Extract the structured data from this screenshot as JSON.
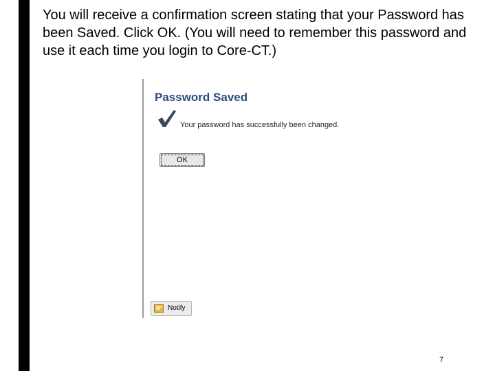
{
  "slide": {
    "instructions": "You will receive a confirmation screen stating that your Password has been Saved.  Click OK.  (You will need to remember this password and use it each time you login to Core-CT.)",
    "page_number": "7"
  },
  "screenshot": {
    "title": "Password Saved",
    "message": "Your password has successfully been changed.",
    "ok_label": "OK",
    "notify_label": "Notify",
    "icons": {
      "check": "checkmark-icon",
      "notify": "notify-icon"
    },
    "colors": {
      "title": "#2a4d7a",
      "check": "#3a4a5a",
      "notify_icon": "#e7b93a"
    }
  }
}
